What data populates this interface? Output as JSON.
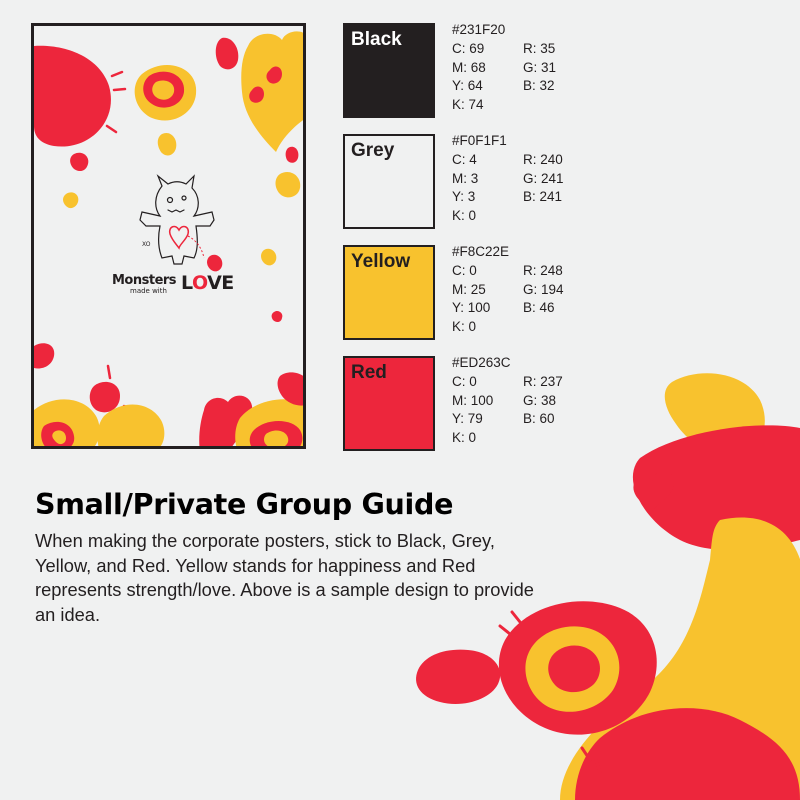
{
  "poster": {
    "brand_word": "Monsters",
    "brand_sub": "made with",
    "brand_love_l": "L",
    "brand_love_o": "O",
    "brand_love_ve": "VE",
    "monster_tag": "XO"
  },
  "swatches": [
    {
      "name": "Black",
      "hex": "#231F20",
      "fill": "#231F20",
      "name_color": "#FFFFFF",
      "c": "C: 69",
      "m": "M: 68",
      "y": "Y: 64",
      "k": "K: 74",
      "r": "R: 35",
      "g": "G: 31",
      "b": "B: 32"
    },
    {
      "name": "Grey",
      "hex": "#F0F1F1",
      "fill": "#F0F1F1",
      "name_color": "#231F20",
      "c": "C: 4",
      "m": "M: 3",
      "y": "Y: 3",
      "k": "K: 0",
      "r": "R: 240",
      "g": "G: 241",
      "b": "B: 241"
    },
    {
      "name": "Yellow",
      "hex": "#F8C22E",
      "fill": "#F8C22E",
      "name_color": "#231F20",
      "c": "C: 0",
      "m": "M: 25",
      "y": "Y: 100",
      "k": "K: 0",
      "r": "R: 248",
      "g": "G: 194",
      "b": "B: 46"
    },
    {
      "name": "Red",
      "hex": "#ED263C",
      "fill": "#ED263C",
      "name_color": "#231F20",
      "c": "C: 0",
      "m": "M: 100",
      "y": "Y: 79",
      "k": "K: 0",
      "r": "R: 237",
      "g": "G: 38",
      "b": "B: 60"
    }
  ],
  "guide": {
    "title": "Small/Private Group Guide",
    "body": "When making the corporate posters, stick to Black, Grey, Yellow, and Red. Yellow stands for happiness and Red represents strength/love. Above is a sample design to provide an idea."
  },
  "colors": {
    "background": "#F0F1F1",
    "yellow": "#F8C22E",
    "red": "#ED263C",
    "black": "#231F20"
  }
}
